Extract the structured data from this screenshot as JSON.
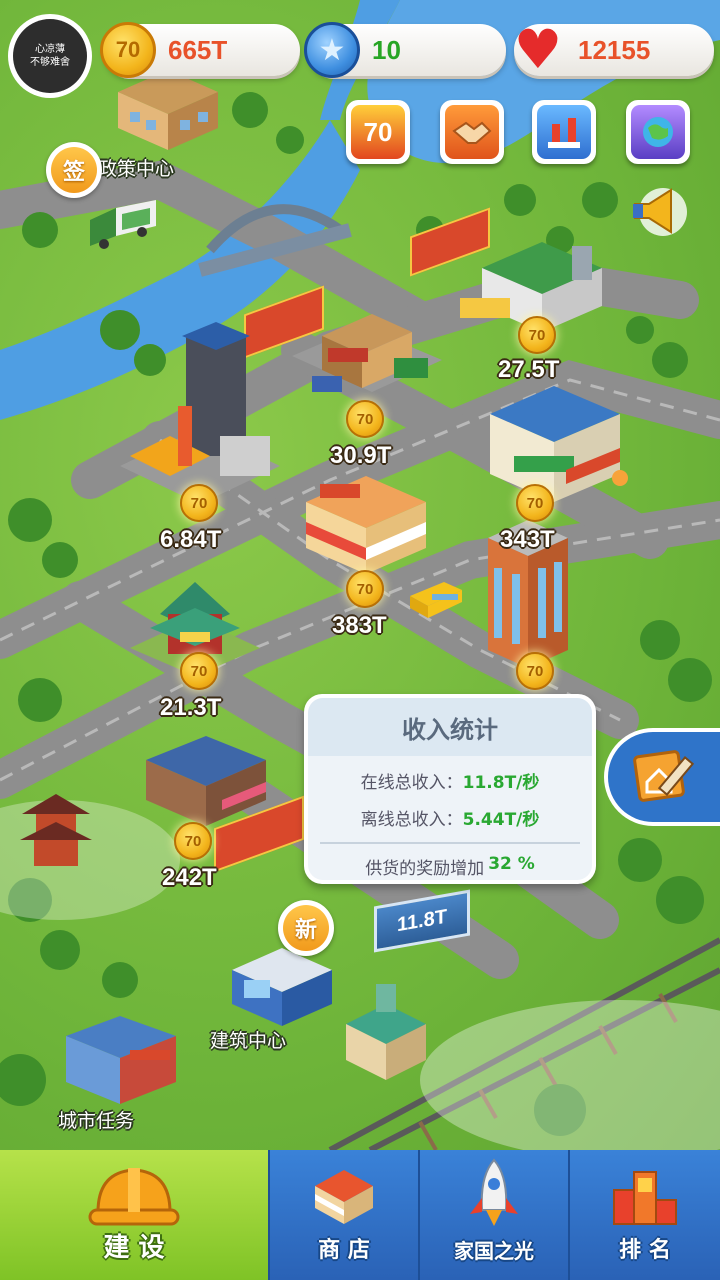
{
  "profile": {
    "avatar_text_line1": "心凉薄",
    "avatar_text_line2": "不够难舍"
  },
  "resources": {
    "coins": "665T",
    "coin_icon_text": "70",
    "stars": "10",
    "hearts": "12155",
    "colors": {
      "coins": "#e8522a",
      "stars": "#27a524",
      "hearts": "#e8522a"
    }
  },
  "top_buttons": [
    {
      "name": "anniversary-70-button",
      "icon": "70-badge-icon",
      "text": "70"
    },
    {
      "name": "handshake-button",
      "icon": "handshake-icon"
    },
    {
      "name": "city-landmark-button",
      "icon": "landmark-icon"
    },
    {
      "name": "globe-button",
      "icon": "globe-icon"
    }
  ],
  "map": {
    "policy_center_label": "政策中心",
    "sign_in_bubble": "签",
    "new_bubble": "新",
    "building_center_label": "建筑中心",
    "city_task_label": "城市任务",
    "billboard_text": "11.8T",
    "coin_badge_text": "70",
    "buildings": [
      {
        "id": "logistics",
        "income": "27.5T"
      },
      {
        "id": "lumber-mill",
        "income": "30.9T"
      },
      {
        "id": "steel-plant",
        "income": "6.84T"
      },
      {
        "id": "market",
        "income": "343T"
      },
      {
        "id": "shop",
        "income": "383T"
      },
      {
        "id": "pavilion",
        "income": "21.3T"
      },
      {
        "id": "office-tower",
        "income": ""
      },
      {
        "id": "residence",
        "income": "242T"
      }
    ]
  },
  "income_popup": {
    "title": "收入统计",
    "online_label": "在线总收入：",
    "online_value": "11.8T/秒",
    "offline_label": "离线总收入：",
    "offline_value": "5.44T/秒",
    "bonus_label": "供货的奖励增加",
    "bonus_value": "32 %"
  },
  "nav": {
    "items": [
      {
        "label": "建 设",
        "icon": "hard-hat-icon",
        "active": true
      },
      {
        "label": "商 店",
        "icon": "shop-icon",
        "active": false
      },
      {
        "label": "家国之光",
        "icon": "rocket-icon",
        "active": false
      },
      {
        "label": "排 名",
        "icon": "podium-icon",
        "active": false
      }
    ]
  }
}
